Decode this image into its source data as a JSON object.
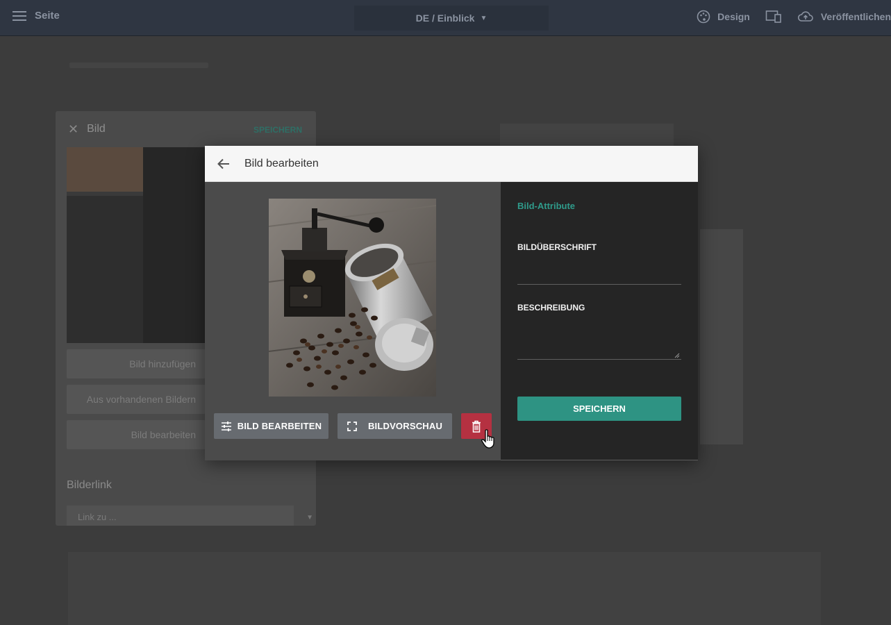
{
  "topbar": {
    "menu_label": "Seite",
    "language_select": "DE / Einblick",
    "design_label": "Design",
    "publish_label": "Veröffentlichen"
  },
  "sidepanel": {
    "title": "Bild",
    "save_label": "SPEICHERN",
    "buttons": [
      "Bild hinzufügen",
      "Aus vorhandenen Bildern",
      "Bild bearbeiten"
    ],
    "link_label": "Bilderlink",
    "link_placeholder": "Link zu ..."
  },
  "modal": {
    "title": "Bild bearbeiten",
    "edit_image_label": "BILD BEARBEITEN",
    "preview_label": "BILDVORSCHAU",
    "attributes": {
      "heading": "Bild-Attribute",
      "caption_label": "BILDÜBERSCHRIFT",
      "caption_value": "",
      "description_label": "BESCHREIBUNG",
      "description_value": "",
      "save_label": "SPEICHERN"
    }
  },
  "colors": {
    "accent": "#2e9383",
    "danger": "#b53141",
    "topbar": "#2f3642"
  },
  "icons": {
    "menu": "hamburger-icon",
    "design": "palette-icon",
    "devices": "devices-icon",
    "publish": "cloud-upload-icon",
    "back": "arrow-left-icon",
    "edit": "tune-sliders-icon",
    "preview": "fullscreen-icon",
    "delete": "trash-icon",
    "cursor": "hand-pointer-icon"
  }
}
